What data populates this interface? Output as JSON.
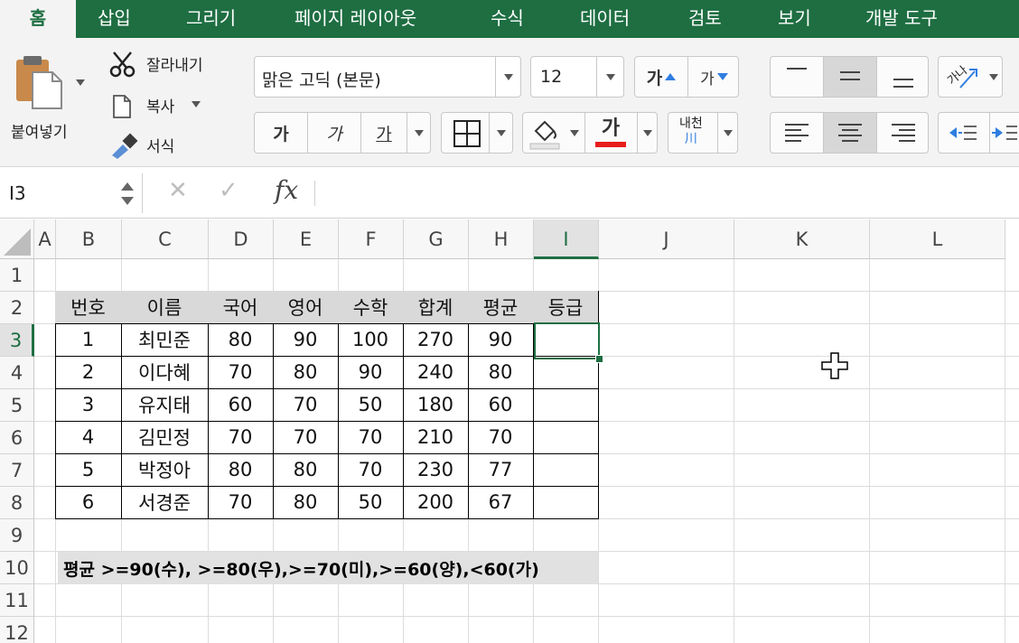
{
  "tabs": [
    {
      "label": "홈",
      "active": true
    },
    {
      "label": "삽입"
    },
    {
      "label": "그리기"
    },
    {
      "label": "페이지 레이아웃"
    },
    {
      "label": "수식"
    },
    {
      "label": "데이터"
    },
    {
      "label": "검토"
    },
    {
      "label": "보기"
    },
    {
      "label": "개발 도구"
    }
  ],
  "ribbon": {
    "paste_label": "붙여넣기",
    "cut_label": "잘라내기",
    "copy_label": "복사",
    "format_label": "서식",
    "font_name": "맑은 고딕 (본문)",
    "font_size": "12",
    "increase_font": "가",
    "decrease_font": "가",
    "bold": "가",
    "italic": "가",
    "underline": "가",
    "font_color_glyph": "가",
    "phonetic_top": "내천",
    "phonetic_bottom": "川",
    "orientation_glyph": "가나",
    "font_color": "#e81c1c",
    "accent_color": "#1e6e42"
  },
  "formula_bar": {
    "name_box": "I3",
    "fx": "fx",
    "formula": ""
  },
  "grid": {
    "columns": [
      "A",
      "B",
      "C",
      "D",
      "E",
      "F",
      "G",
      "H",
      "I",
      "J",
      "K",
      "L"
    ],
    "rows": [
      "1",
      "2",
      "3",
      "4",
      "5",
      "6",
      "7",
      "8",
      "9",
      "10",
      "11",
      "12"
    ],
    "selected_cell": "I3",
    "table_header": [
      "번호",
      "이름",
      "국어",
      "영어",
      "수학",
      "합계",
      "평균",
      "등급"
    ],
    "table_rows": [
      [
        "1",
        "최민준",
        "80",
        "90",
        "100",
        "270",
        "90",
        ""
      ],
      [
        "2",
        "이다혜",
        "70",
        "80",
        "90",
        "240",
        "80",
        ""
      ],
      [
        "3",
        "유지태",
        "60",
        "70",
        "50",
        "180",
        "60",
        ""
      ],
      [
        "4",
        "김민정",
        "70",
        "70",
        "70",
        "210",
        "70",
        ""
      ],
      [
        "5",
        "박정아",
        "80",
        "80",
        "70",
        "230",
        "77",
        ""
      ],
      [
        "6",
        "서경준",
        "70",
        "80",
        "50",
        "200",
        "67",
        ""
      ]
    ],
    "note": "평균 >=90(수), >=80(우),>=70(미),>=60(양),<60(가)"
  }
}
